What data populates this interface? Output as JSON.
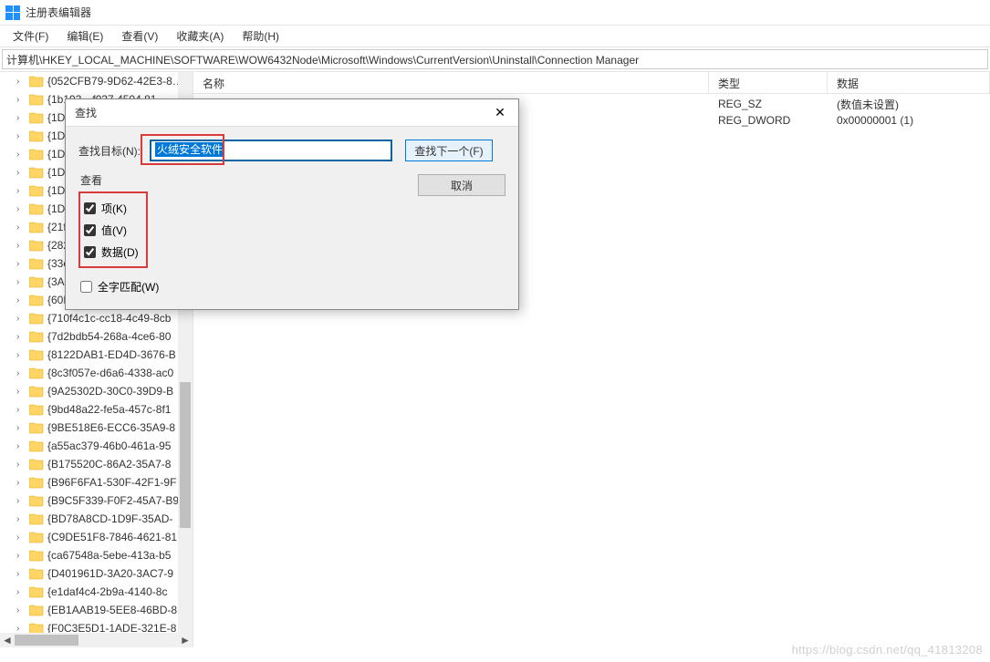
{
  "window": {
    "title": "注册表编辑器"
  },
  "menu": {
    "file": "文件(F)",
    "edit": "编辑(E)",
    "view": "查看(V)",
    "favorites": "收藏夹(A)",
    "help": "帮助(H)"
  },
  "address": {
    "path": "计算机\\HKEY_LOCAL_MACHINE\\SOFTWARE\\WOW6432Node\\Microsoft\\Windows\\CurrentVersion\\Uninstall\\Connection Manager"
  },
  "tree": {
    "items": [
      "{052CFB79-9D62-42E3-8…",
      "{1b193…f037 4504 81",
      "{1D8",
      "{1D8",
      "{1D8",
      "{1D8",
      "{1D8",
      "{1D8",
      "{21f",
      "{282",
      "{33c",
      "{3AC",
      "{60EC980A-BDA2-4CB6-A",
      "{710f4c1c-cc18-4c49-8cb",
      "{7d2bdb54-268a-4ce6-80",
      "{8122DAB1-ED4D-3676-B",
      "{8c3f057e-d6a6-4338-ac0",
      "{9A25302D-30C0-39D9-B",
      "{9bd48a22-fe5a-457c-8f1",
      "{9BE518E6-ECC6-35A9-8",
      "{a55ac379-46b0-461a-95",
      "{B175520C-86A2-35A7-8",
      "{B96F6FA1-530F-42F1-9F",
      "{B9C5F339-F0F2-45A7-B9",
      "{BD78A8CD-1D9F-35AD-",
      "{C9DE51F8-7846-4621-81",
      "{ca67548a-5ebe-413a-b5",
      "{D401961D-3A20-3AC7-9",
      "{e1daf4c4-2b9a-4140-8c",
      "{EB1AAB19-5EE8-46BD-8",
      "{F0C3E5D1-1ADE-321E-8"
    ]
  },
  "list": {
    "headers": {
      "name": "名称",
      "type": "类型",
      "data": "数据"
    },
    "rows": [
      {
        "name": "",
        "type": "REG_SZ",
        "data": "(数值未设置)"
      },
      {
        "name": "",
        "type": "REG_DWORD",
        "data": "0x00000001 (1)"
      }
    ]
  },
  "find_dialog": {
    "title": "查找",
    "close": "✕",
    "target_label": "查找目标(N):",
    "target_value": "火绒安全软件",
    "find_next": "查找下一个(F)",
    "cancel": "取消",
    "look_at_label": "查看",
    "chk_keys": "项(K)",
    "chk_values": "值(V)",
    "chk_data": "数据(D)",
    "chk_whole": "全字匹配(W)"
  },
  "watermark": "https://blog.csdn.net/qq_41813208"
}
